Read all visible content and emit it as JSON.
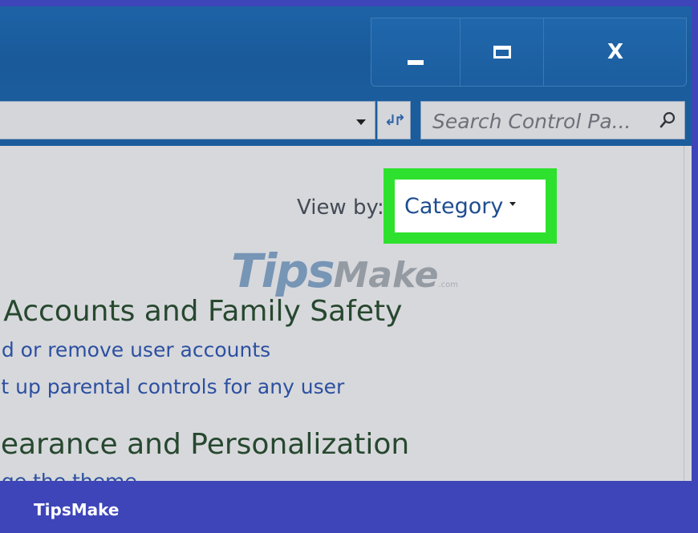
{
  "window": {
    "caption": {
      "minimize_icon": "minimize-icon",
      "maximize_icon": "maximize-icon",
      "close_icon": "close-icon",
      "close_glyph": "X"
    }
  },
  "address_bar": {
    "refresh_glyph": "↲↱",
    "search_placeholder": "Search Control Pa...",
    "search_icon": "search-icon"
  },
  "view_by": {
    "label": "View by:",
    "value": "Category",
    "highlight_color": "#2ee12e"
  },
  "sections": [
    {
      "title": "r Accounts and Family Safety",
      "links": [
        "dd or remove user accounts",
        "et up parental controls for any user"
      ]
    },
    {
      "title": "pearance and Personalization",
      "links": [
        "nge the theme"
      ]
    }
  ],
  "watermark": {
    "tips": "Tips",
    "make": "Make",
    "suffix": ".com"
  },
  "footer": {
    "brand": "TipsMake"
  },
  "colors": {
    "titlebar": "#1b5c9c",
    "frame": "#3e45b9",
    "link": "#2c50a0",
    "section_title": "#27482f"
  }
}
